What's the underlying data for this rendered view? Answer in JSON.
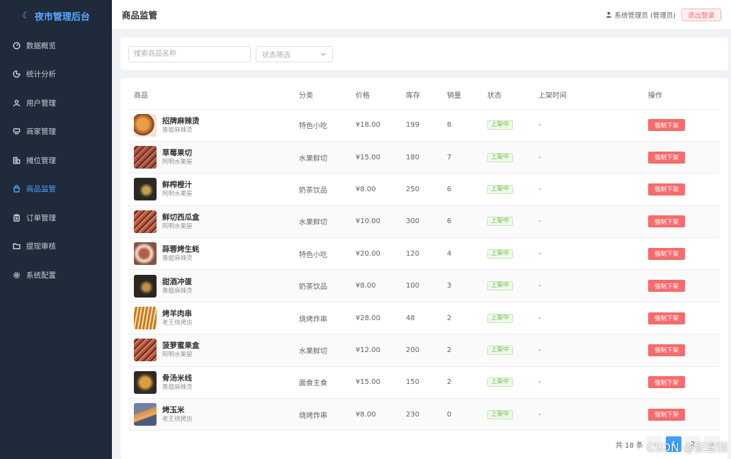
{
  "sidebar": {
    "brand": "夜市管理后台",
    "items": [
      {
        "label": "数据概览",
        "icon": "dashboard-icon",
        "active": false
      },
      {
        "label": "统计分析",
        "icon": "pie-chart-icon",
        "active": false
      },
      {
        "label": "用户管理",
        "icon": "user-icon",
        "active": false
      },
      {
        "label": "商家管理",
        "icon": "shop-icon",
        "active": false
      },
      {
        "label": "摊位管理",
        "icon": "building-icon",
        "active": false
      },
      {
        "label": "商品监管",
        "icon": "bag-icon",
        "active": true
      },
      {
        "label": "订单管理",
        "icon": "clipboard-icon",
        "active": false
      },
      {
        "label": "提现审核",
        "icon": "folder-icon",
        "active": false
      },
      {
        "label": "系统配置",
        "icon": "gear-icon",
        "active": false
      }
    ]
  },
  "header": {
    "title": "商品监管",
    "user": "系统管理员 (管理员)",
    "logout": "退出登录"
  },
  "filter": {
    "search_placeholder": "搜索商品名称",
    "status_placeholder": "状态筛选"
  },
  "table": {
    "columns": [
      "商品",
      "分类",
      "价格",
      "库存",
      "销量",
      "状态",
      "上架时间",
      "操作"
    ],
    "rows": [
      {
        "name": "招牌麻辣烫",
        "shop": "香姐麻辣烫",
        "category": "特色小吃",
        "price": "¥18.00",
        "stock": "199",
        "sales": "8",
        "status": "上架中",
        "time": "-",
        "action": "强制下架"
      },
      {
        "name": "草莓果切",
        "shop": "阿明水果屋",
        "category": "水果鲜切",
        "price": "¥15.00",
        "stock": "180",
        "sales": "7",
        "status": "上架中",
        "time": "-",
        "action": "强制下架"
      },
      {
        "name": "鲜榨橙汁",
        "shop": "阿明水果屋",
        "category": "奶茶饮品",
        "price": "¥8.00",
        "stock": "250",
        "sales": "6",
        "status": "上架中",
        "time": "-",
        "action": "强制下架"
      },
      {
        "name": "鲜切西瓜盒",
        "shop": "阿明水果屋",
        "category": "水果鲜切",
        "price": "¥10.00",
        "stock": "300",
        "sales": "6",
        "status": "上架中",
        "time": "-",
        "action": "强制下架"
      },
      {
        "name": "蒜蓉烤生蚝",
        "shop": "香姐麻辣烫",
        "category": "特色小吃",
        "price": "¥20.00",
        "stock": "120",
        "sales": "4",
        "status": "上架中",
        "time": "-",
        "action": "强制下架"
      },
      {
        "name": "甜酒冲蛋",
        "shop": "香姐麻辣烫",
        "category": "奶茶饮品",
        "price": "¥8.00",
        "stock": "100",
        "sales": "3",
        "status": "上架中",
        "time": "-",
        "action": "强制下架"
      },
      {
        "name": "烤羊肉串",
        "shop": "老王烧烤店",
        "category": "烧烤炸串",
        "price": "¥28.00",
        "stock": "48",
        "sales": "2",
        "status": "上架中",
        "time": "-",
        "action": "强制下架"
      },
      {
        "name": "菠萝蜜果盒",
        "shop": "阿明水果屋",
        "category": "水果鲜切",
        "price": "¥12.00",
        "stock": "200",
        "sales": "2",
        "status": "上架中",
        "time": "-",
        "action": "强制下架"
      },
      {
        "name": "骨汤米线",
        "shop": "香姐麻辣烫",
        "category": "面食主食",
        "price": "¥15.00",
        "stock": "150",
        "sales": "2",
        "status": "上架中",
        "time": "-",
        "action": "强制下架"
      },
      {
        "name": "烤玉米",
        "shop": "老王烧烤店",
        "category": "烧烤炸串",
        "price": "¥8.00",
        "stock": "230",
        "sales": "0",
        "status": "上架中",
        "time": "-",
        "action": "强制下架"
      }
    ]
  },
  "pagination": {
    "total": "共 18 条",
    "pages": [
      "1",
      "2"
    ],
    "current": "1"
  },
  "watermark": "CSDN @张宜强",
  "colors": {
    "sidebar_bg": "#1f2a3a",
    "accent": "#409eff",
    "danger": "#f56c6c",
    "success": "#67c23a"
  }
}
